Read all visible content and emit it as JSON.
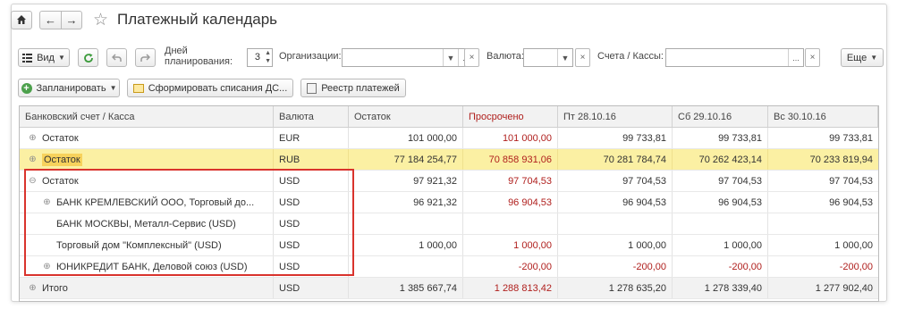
{
  "window": {
    "title": "Платежный календарь",
    "nav_back": "←",
    "nav_forward": "→"
  },
  "toolbar": {
    "view_label": "Вид",
    "days_label_1": "Дней",
    "days_label_2": "планирования:",
    "days_value": "3",
    "org_label": "Организации:",
    "org_value": "",
    "currency_label": "Валюта:",
    "currency_value": "",
    "accounts_label": "Счета / Кассы:",
    "accounts_value": "",
    "more_label": "Еще",
    "ellipsis": "...",
    "clear": "×"
  },
  "actions": {
    "plan_label": "Запланировать",
    "generate_label": "Сформировать списания ДС...",
    "registry_label": "Реестр платежей"
  },
  "table": {
    "columns": [
      "Банковский счет / Касса",
      "Валюта",
      "Остаток",
      "Просрочено",
      "Пт 28.10.16",
      "Сб 29.10.16",
      "Вс 30.10.16"
    ],
    "rows": [
      {
        "toggle": "⊕",
        "name": "Остаток",
        "currency": "EUR",
        "balance": "101 000,00",
        "overdue": "101 000,00",
        "d1": "99 733,81",
        "d2": "99 733,81",
        "d3": "99 733,81"
      },
      {
        "toggle": "⊕",
        "name": "Остаток",
        "currency": "RUB",
        "balance": "77 184 254,77",
        "overdue": "70 858 931,06",
        "d1": "70 281 784,74",
        "d2": "70 262 423,14",
        "d3": "70 233 819,94"
      },
      {
        "toggle": "⊖",
        "name": "Остаток",
        "currency": "USD",
        "balance": "97 921,32",
        "overdue": "97 704,53",
        "d1": "97 704,53",
        "d2": "97 704,53",
        "d3": "97 704,53"
      },
      {
        "toggle": "⊕",
        "name": "БАНК КРЕМЛЕВСКИЙ ООО, Торговый до...",
        "currency": "USD",
        "balance": "96 921,32",
        "overdue": "96 904,53",
        "d1": "96 904,53",
        "d2": "96 904,53",
        "d3": "96 904,53"
      },
      {
        "toggle": "",
        "name": "БАНК МОСКВЫ, Металл-Сервис (USD)",
        "currency": "USD",
        "balance": "",
        "overdue": "",
        "d1": "",
        "d2": "",
        "d3": ""
      },
      {
        "toggle": "",
        "name": "Торговый дом \"Комплексный\" (USD)",
        "currency": "USD",
        "balance": "1 000,00",
        "overdue": "1 000,00",
        "d1": "1 000,00",
        "d2": "1 000,00",
        "d3": "1 000,00"
      },
      {
        "toggle": "⊕",
        "name": "ЮНИКРЕДИТ БАНК, Деловой союз (USD)",
        "currency": "USD",
        "balance": "",
        "overdue": "-200,00",
        "d1": "-200,00",
        "d2": "-200,00",
        "d3": "-200,00"
      },
      {
        "toggle": "⊕",
        "name": "Итого",
        "currency": "USD",
        "balance": "1 385 667,74",
        "overdue": "1 288 813,42",
        "d1": "1 278 635,20",
        "d2": "1 278 339,40",
        "d3": "1 277 902,40"
      }
    ]
  },
  "colors": {
    "overdue_text": "#b0201e",
    "highlight_row": "#fbf0a3",
    "highlight_label": "#f7d25c",
    "annotation_box": "#d9332d"
  }
}
